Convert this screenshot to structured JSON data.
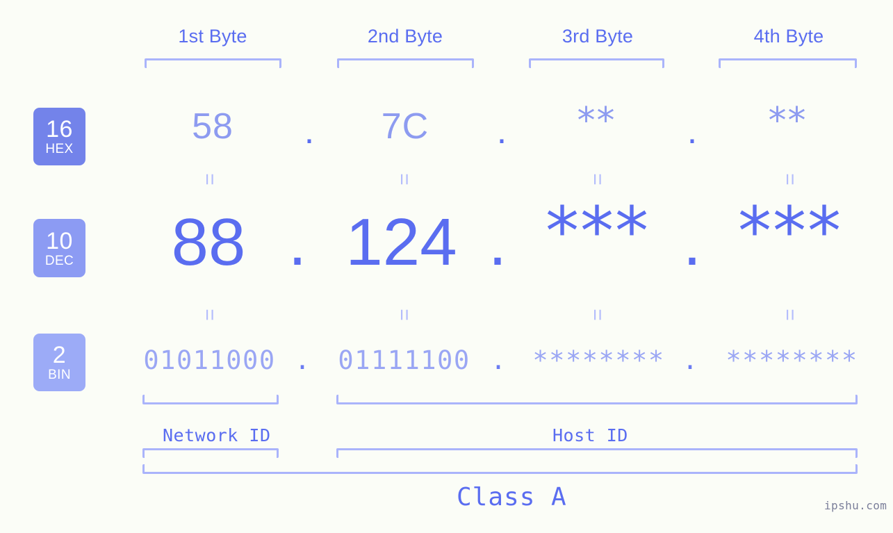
{
  "page": {
    "background_color": "#fbfdf7",
    "accent_strong": "#5a6df0",
    "accent_mid": "#8d9bf0",
    "accent_light": "#aab4fb",
    "watermark": "ipshu.com"
  },
  "byte_headers": [
    {
      "label": "1st Byte"
    },
    {
      "label": "2nd Byte"
    },
    {
      "label": "3rd Byte"
    },
    {
      "label": "4th Byte"
    }
  ],
  "radix_badges": [
    {
      "number": "16",
      "name": "HEX",
      "color": "#7383ea"
    },
    {
      "number": "10",
      "name": "DEC",
      "color": "#8c9bf3"
    },
    {
      "number": "2",
      "name": "BIN",
      "color": "#9cabf7"
    }
  ],
  "rows": {
    "hex": {
      "values": [
        "58",
        "7C",
        "**",
        "**"
      ],
      "separator": "."
    },
    "dec": {
      "values": [
        "88",
        "124",
        "***",
        "***"
      ],
      "separator": "."
    },
    "bin": {
      "values": [
        "01011000",
        "01111100",
        "********",
        "********"
      ],
      "separator": "."
    }
  },
  "equals_glyph": "=",
  "segments": {
    "network_id": "Network ID",
    "host_id": "Host ID",
    "class": "Class A"
  }
}
